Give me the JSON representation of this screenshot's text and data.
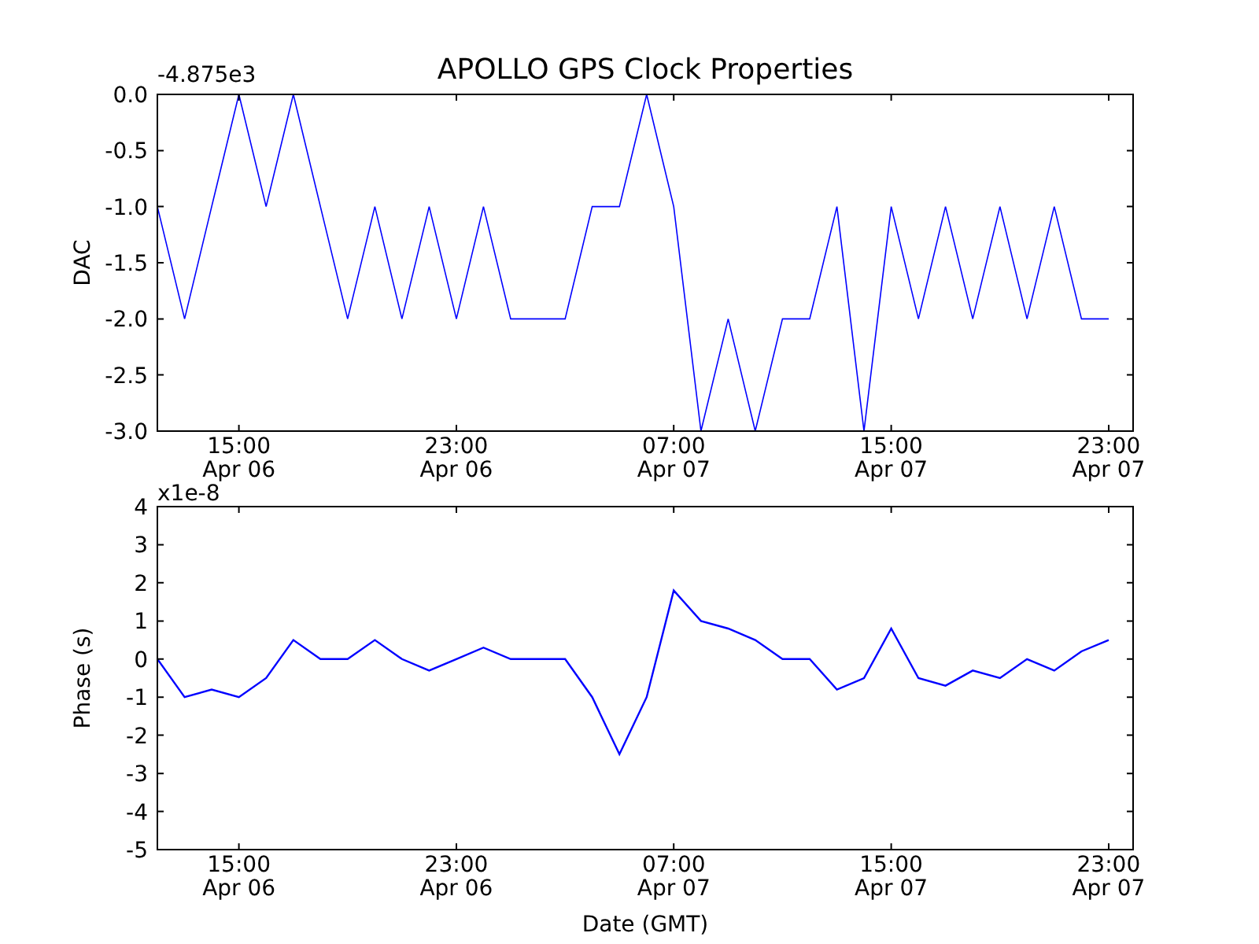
{
  "figure": {
    "charts": [
      {
        "offset_text": "-4.875e3",
        "chart_data": {
          "type": "line",
          "title": "APOLLO GPS Clock Properties",
          "ylabel": "DAC",
          "categories": [
            null,
            null,
            null,
            "15:00\nApr 06",
            null,
            null,
            null,
            null,
            null,
            null,
            null,
            "23:00\nApr 06",
            null,
            null,
            null,
            null,
            null,
            null,
            null,
            "07:00\nApr 07",
            null,
            null,
            null,
            null,
            null,
            null,
            null,
            "15:00\nApr 07",
            null,
            null,
            null,
            null,
            null,
            null,
            null,
            "23:00\nApr 07"
          ],
          "series": [
            {
              "color": "#0000ff",
              "values": [
                -1,
                -2,
                -1,
                0,
                -1,
                0,
                -1,
                -2,
                -1,
                -2,
                -1,
                -2,
                -1,
                -2,
                -2,
                -2,
                -1,
                -1,
                0,
                -1,
                -3,
                -2,
                -3,
                -2,
                -2,
                -1,
                -3,
                -1,
                -2,
                -1,
                -2,
                -1,
                -2,
                -1,
                -2,
                -2
              ]
            }
          ],
          "ylim": [
            -3,
            0
          ],
          "yticks": [
            {
              "value": 0,
              "label": "0.0"
            },
            {
              "value": -0.5,
              "label": "-0.5"
            },
            {
              "value": -1,
              "label": "-1.0"
            },
            {
              "value": -1.5,
              "label": "-1.5"
            },
            {
              "value": -2,
              "label": "-2.0"
            },
            {
              "value": -2.5,
              "label": "-2.5"
            },
            {
              "value": -3,
              "label": "-3.0"
            }
          ]
        }
      },
      {
        "offset_text": "x1e-8",
        "chart_data": {
          "type": "line",
          "xlabel": "Date (GMT)",
          "ylabel": "Phase (s)",
          "categories": [
            null,
            null,
            null,
            "15:00\nApr 06",
            null,
            null,
            null,
            null,
            null,
            null,
            null,
            "23:00\nApr 06",
            null,
            null,
            null,
            null,
            null,
            null,
            null,
            "07:00\nApr 07",
            null,
            null,
            null,
            null,
            null,
            null,
            null,
            "15:00\nApr 07",
            null,
            null,
            null,
            null,
            null,
            null,
            null,
            "23:00\nApr 07"
          ],
          "series": [
            {
              "color": "#0000ff",
              "values": [
                0,
                -1,
                -0.8,
                -1,
                -0.5,
                0.5,
                0,
                0,
                0.5,
                0,
                -0.3,
                0,
                0.3,
                0,
                0,
                0,
                -1,
                -2.5,
                -1,
                1.8,
                1,
                0.8,
                0.5,
                0,
                0,
                -0.8,
                -0.5,
                0.8,
                -0.5,
                -0.7,
                -0.3,
                -0.5,
                0,
                -0.3,
                0.2,
                0.5
              ]
            }
          ],
          "ylim": [
            -5,
            4
          ],
          "yticks": [
            -5,
            -4,
            -3,
            -2,
            -1,
            0,
            1,
            2,
            3,
            4
          ]
        }
      }
    ]
  }
}
